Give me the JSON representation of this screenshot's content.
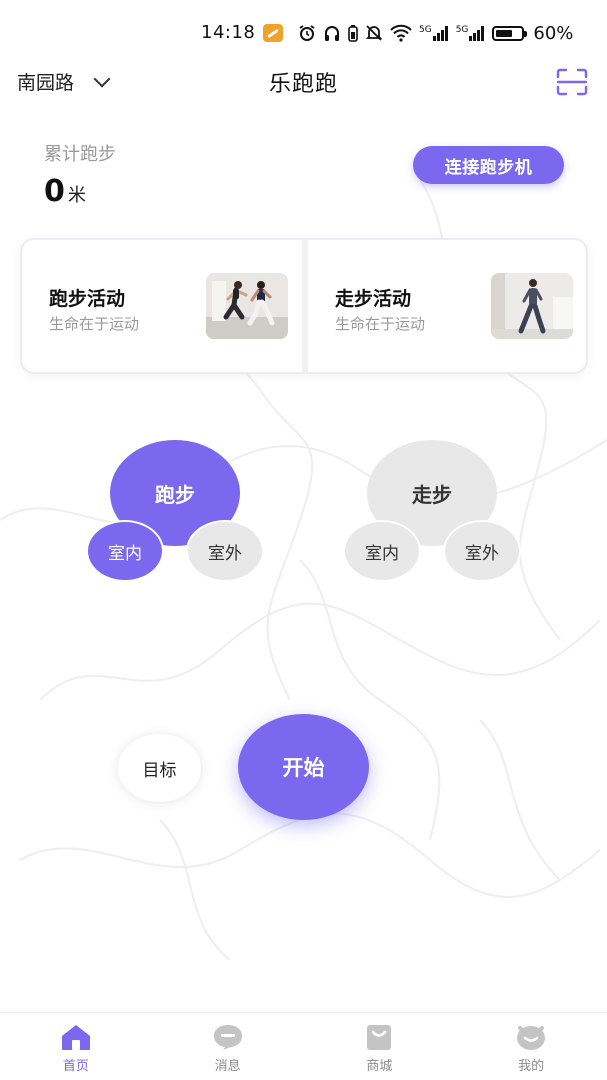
{
  "status_bar": {
    "time": "14:18",
    "battery_percent": "60%",
    "network_5g_a": "5G",
    "network_5g_b": "5G"
  },
  "header": {
    "location": "南园路",
    "title": "乐跑跑"
  },
  "stats": {
    "label": "累计跑步",
    "value": "0",
    "unit": "米"
  },
  "connect_button": "连接跑步机",
  "activity_cards": [
    {
      "title": "跑步活动",
      "subtitle": "生命在于运动"
    },
    {
      "title": "走步活动",
      "subtitle": "生命在于运动"
    }
  ],
  "mode_groups": {
    "run": {
      "label": "跑步",
      "indoor": "室内",
      "outdoor": "室外",
      "selected": "indoor"
    },
    "walk": {
      "label": "走步",
      "indoor": "室内",
      "outdoor": "室外",
      "selected": "none"
    }
  },
  "goal_button": "目标",
  "start_button": "开始",
  "tabs": [
    {
      "label": "首页",
      "icon": "home-icon",
      "active": true
    },
    {
      "label": "消息",
      "icon": "message-icon",
      "active": false
    },
    {
      "label": "商城",
      "icon": "shop-bag-icon",
      "active": false
    },
    {
      "label": "我的",
      "icon": "profile-icon",
      "active": false
    }
  ],
  "colors": {
    "accent": "#7b68ee",
    "inactive_bubble": "#e8e8e8",
    "muted_text": "#9a9a9a",
    "tab_inactive_icon": "#c4c4c4"
  }
}
